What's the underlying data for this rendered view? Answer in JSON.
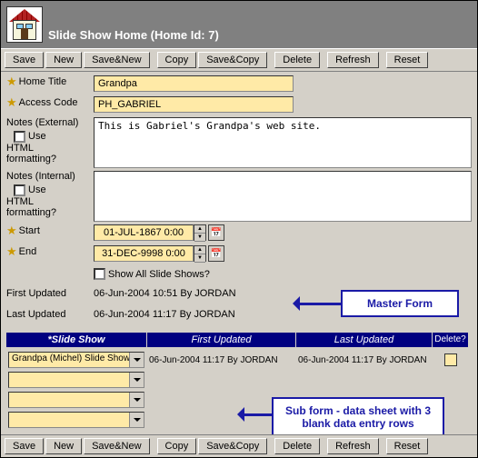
{
  "window": {
    "title": "Slide Show Home (Home Id: 7)"
  },
  "toolbar": {
    "save": "Save",
    "new": "New",
    "savenew": "Save&New",
    "copy": "Copy",
    "savecopy": "Save&Copy",
    "delete": "Delete",
    "refresh": "Refresh",
    "reset": "Reset"
  },
  "labels": {
    "home_title": "Home Title",
    "access_code": "Access Code",
    "notes_ext": "Notes (External)",
    "use_html": "Use HTML formatting?",
    "notes_int": "Notes (Internal)",
    "start": "Start",
    "end": "End",
    "show_all": "Show All Slide Shows?",
    "first_updated": "First Updated",
    "last_updated": "Last Updated"
  },
  "fields": {
    "home_title": "Grandpa",
    "access_code": "PH_GABRIEL",
    "notes_ext": "This is Gabriel's Grandpa's web site.",
    "notes_int": "",
    "start": "01-JUL-1867 0:00",
    "end": "31-DEC-9998 0:00",
    "first_updated": "06-Jun-2004 10:51  By  JORDAN",
    "last_updated": "06-Jun-2004 11:17  By  JORDAN"
  },
  "subform": {
    "headers": {
      "slide": "*Slide Show",
      "first": "First Updated",
      "last": "Last Updated",
      "del": "Delete?"
    },
    "rows": [
      {
        "slide": "Grandpa (Michel) Slide Show",
        "first": "06-Jun-2004 11:17  By  JORDAN",
        "last": "06-Jun-2004 11:17  By  JORDAN"
      },
      {
        "slide": "",
        "first": "",
        "last": ""
      },
      {
        "slide": "",
        "first": "",
        "last": ""
      },
      {
        "slide": "",
        "first": "",
        "last": ""
      }
    ]
  },
  "callouts": {
    "master": "Master Form",
    "sub": "Sub form - data sheet with 3 blank data entry rows"
  }
}
